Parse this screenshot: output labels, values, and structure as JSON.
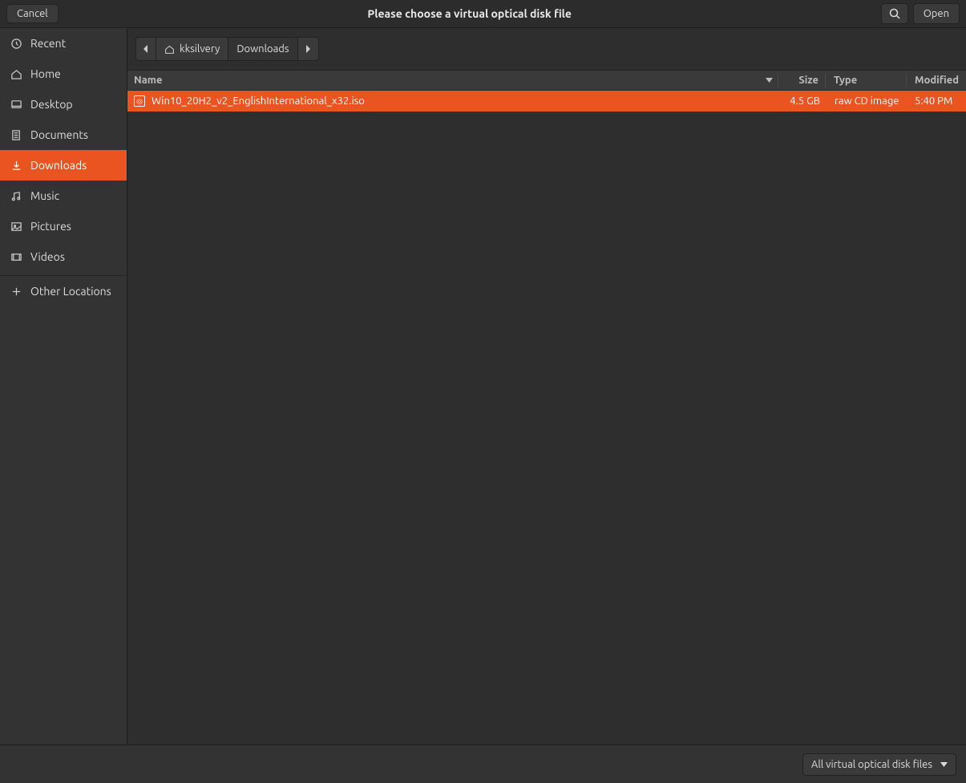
{
  "titlebar": {
    "cancel": "Cancel",
    "title": "Please choose a virtual optical disk file",
    "open": "Open"
  },
  "sidebar": {
    "items": [
      {
        "label": "Recent"
      },
      {
        "label": "Home"
      },
      {
        "label": "Desktop"
      },
      {
        "label": "Documents"
      },
      {
        "label": "Downloads"
      },
      {
        "label": "Music"
      },
      {
        "label": "Pictures"
      },
      {
        "label": "Videos"
      }
    ],
    "other_locations": "Other Locations"
  },
  "breadcrumb": {
    "user": "kksilvery",
    "current": "Downloads"
  },
  "columns": {
    "name": "Name",
    "size": "Size",
    "type": "Type",
    "modified": "Modified"
  },
  "files": [
    {
      "name": "Win10_20H2_v2_EnglishInternational_x32.iso",
      "size": "4.5 GB",
      "type": "raw CD image",
      "modified": "5:40 PM"
    }
  ],
  "footer": {
    "filter": "All virtual optical disk files"
  }
}
